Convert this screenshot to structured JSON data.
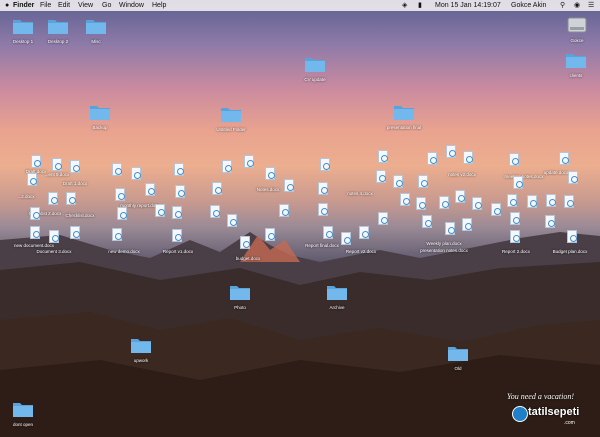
{
  "menubar": {
    "apple": "",
    "app": "Finder",
    "items": [
      "File",
      "Edit",
      "View",
      "Go",
      "Window",
      "Help"
    ],
    "datetime": "Mon 15 Jan  14:19:07",
    "user": "Gokce Akin"
  },
  "folders": {
    "desktop1": "Desktop 1",
    "desktop2": "Desktop 2",
    "misc": "Misc",
    "cv": "CV update",
    "backup": "Backup",
    "untitled": "Untitled Folder",
    "presentation": "presentation final",
    "photo": "Photo",
    "archive": "Archive",
    "unnamed": "upwork",
    "old": "Old",
    "clients": "clients",
    "dont_open": "dont open"
  },
  "disk": {
    "label": "Gokce"
  },
  "documents": [
    "Draft.docx",
    "...ent 5.docx",
    "Draft 1.docx",
    "...2.docx",
    "Checklist 2.docx",
    "Checklist.docx",
    "Meeting notes.docx",
    "Report 2.docx",
    "Draft 3.docx",
    "new document.docx",
    "Document 3.docx",
    "notes 4.docx",
    "Report.docx",
    "budget.docx",
    "Notes.docx",
    "summary.docx",
    "Project.docx",
    "invoice.docx",
    "Report v2.docx",
    "Report final.docx",
    "Weekly plan.docx",
    "meeting notes.docx",
    "presentation notes.docx",
    "notes v2.docx",
    "Report 2.docx",
    "Budget plan.docx",
    "update.docx",
    "monthly report.docx",
    "new demo.docx",
    "Report v1.docx"
  ],
  "brand": {
    "tagline": "You need a vacation!",
    "name": "tatilsepeti",
    "domain": ".com"
  },
  "colors": {
    "folder": "#72b8ec",
    "folder_dark": "#5aa2da",
    "menubar": "#ebe8eb"
  }
}
